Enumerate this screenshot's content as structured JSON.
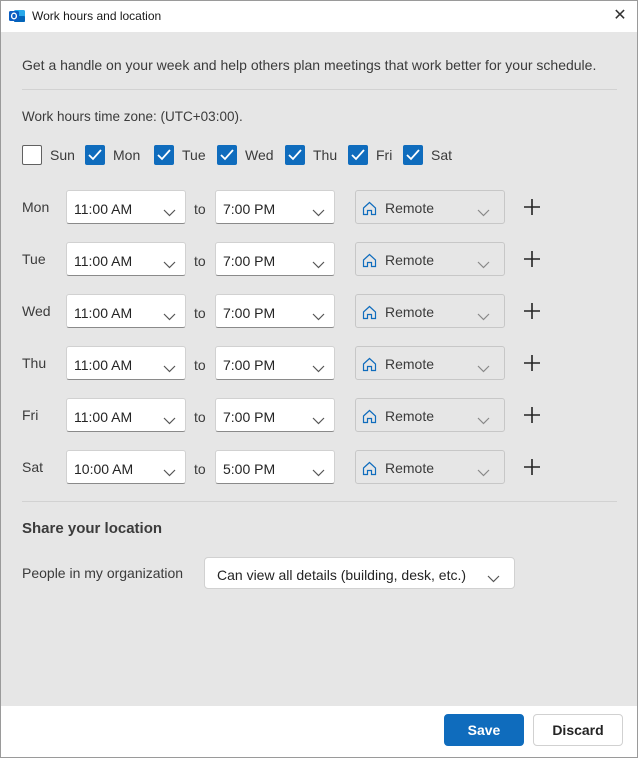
{
  "window": {
    "title": "Work hours and location",
    "close_glyph": "✕"
  },
  "intro": "Get a handle on your week and help others plan meetings that work better for your schedule.",
  "timezone_label": "Work hours time zone: (UTC+03:00).",
  "days": [
    {
      "label": "Sun",
      "checked": false
    },
    {
      "label": "Mon",
      "checked": true
    },
    {
      "label": "Tue",
      "checked": true
    },
    {
      "label": "Wed",
      "checked": true
    },
    {
      "label": "Thu",
      "checked": true
    },
    {
      "label": "Fri",
      "checked": true
    },
    {
      "label": "Sat",
      "checked": true
    }
  ],
  "to_label": "to",
  "schedule": [
    {
      "day": "Mon",
      "start": "11:00 AM",
      "end": "7:00 PM",
      "location": "Remote"
    },
    {
      "day": "Tue",
      "start": "11:00 AM",
      "end": "7:00 PM",
      "location": "Remote"
    },
    {
      "day": "Wed",
      "start": "11:00 AM",
      "end": "7:00 PM",
      "location": "Remote"
    },
    {
      "day": "Thu",
      "start": "11:00 AM",
      "end": "7:00 PM",
      "location": "Remote"
    },
    {
      "day": "Fri",
      "start": "11:00 AM",
      "end": "7:00 PM",
      "location": "Remote"
    },
    {
      "day": "Sat",
      "start": "10:00 AM",
      "end": "5:00 PM",
      "location": "Remote"
    }
  ],
  "share": {
    "heading": "Share your location",
    "people_label": "People in my organization",
    "permission": "Can view all details (building, desk, etc.)"
  },
  "footer": {
    "save_label": "Save",
    "discard_label": "Discard"
  },
  "colors": {
    "accent": "#0f6cbd",
    "background": "#e6e6e6"
  },
  "icons": {
    "app": "outlook-icon",
    "location": "home-icon",
    "add": "plus-icon",
    "dropdown": "chevron-down-icon"
  }
}
